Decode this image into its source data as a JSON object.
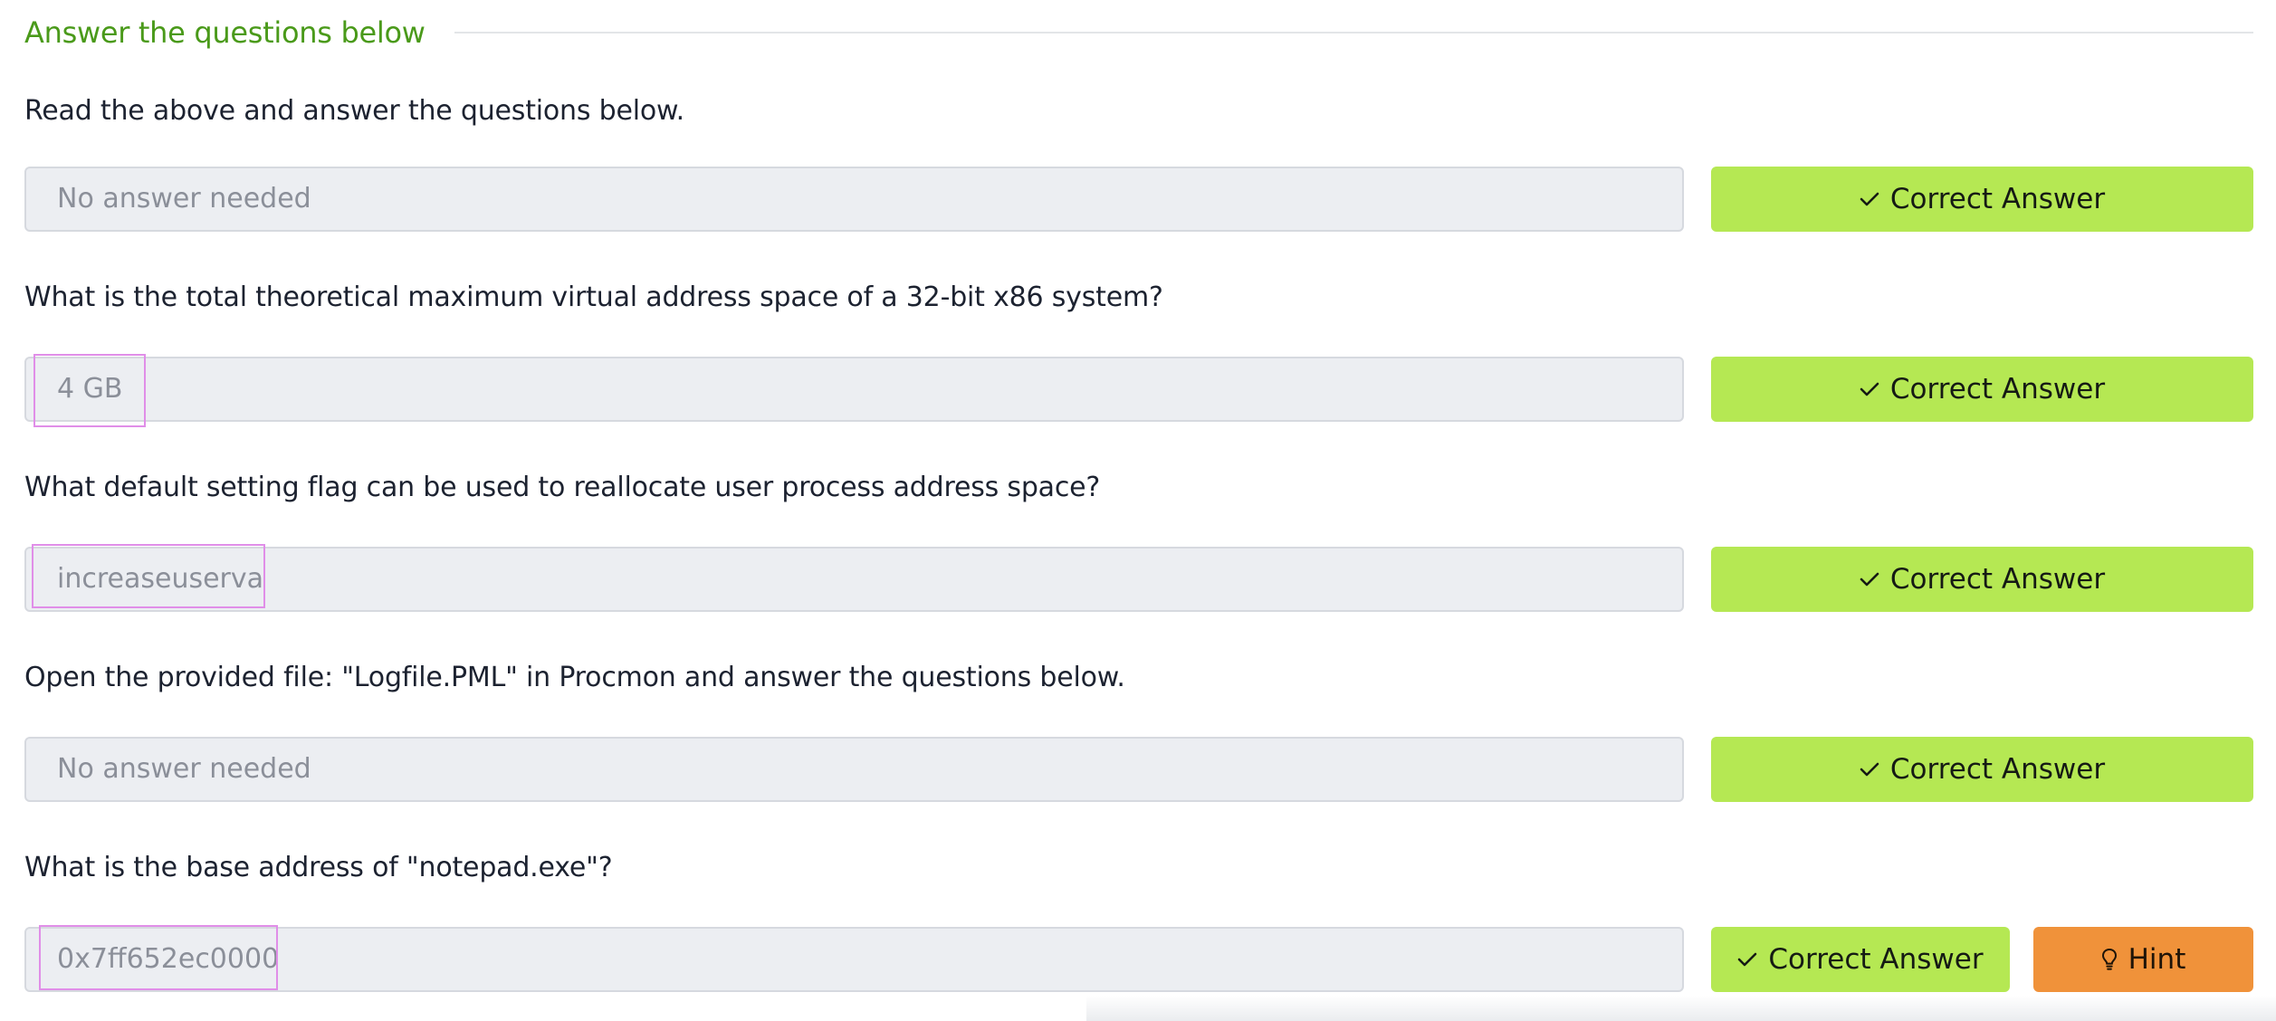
{
  "section": {
    "title": "Answer the questions below"
  },
  "items": [
    {
      "question": "Read the above and answer the questions below.",
      "answer": "No answer needed",
      "button": "Correct Answer"
    },
    {
      "question": "What is the total theoretical maximum virtual address space of a 32-bit x86 system?",
      "answer": "4 GB",
      "button": "Correct Answer"
    },
    {
      "question": "What default setting flag can be used to reallocate user process address space?",
      "answer": "increaseuserva",
      "button": "Correct Answer"
    },
    {
      "question": "Open the provided file: \"Logfile.PML\" in Procmon and answer the questions below.",
      "answer": "No answer needed",
      "button": "Correct Answer"
    },
    {
      "question": "What is the base address of \"notepad.exe\"?",
      "answer": "0x7ff652ec0000",
      "button": "Correct Answer",
      "hint": "Hint"
    }
  ],
  "icons": {
    "correct": "check-icon",
    "hint": "lightbulb-icon"
  },
  "colors": {
    "section_title": "#4a9a1a",
    "correct_button": "#b5e853",
    "hint_button": "#f0923a",
    "answer_field_bg": "#eceef2",
    "highlight": "#e08ee8"
  }
}
